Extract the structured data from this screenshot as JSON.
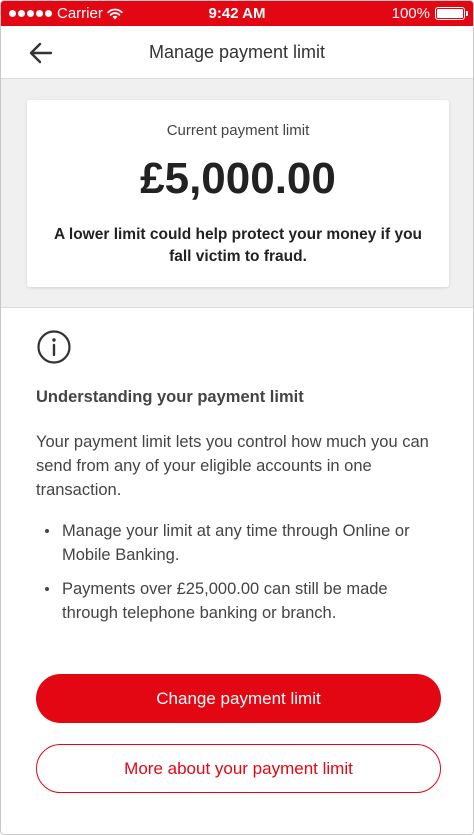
{
  "status_bar": {
    "carrier": "Carrier",
    "time": "9:42 AM",
    "battery": "100%",
    "color": "#e30613"
  },
  "header": {
    "title": "Manage payment limit",
    "back_icon": "arrow-left-icon"
  },
  "limit_card": {
    "label": "Current payment limit",
    "amount": "£5,000.00",
    "note": "A lower limit could help protect your money if you fall victim to fraud."
  },
  "info": {
    "icon": "info-icon",
    "heading": "Understanding your payment limit",
    "body": "Your payment limit lets you control how much you can send from any of your eligible accounts in one transaction.",
    "bullets": [
      "Manage your limit at any time through Online or Mobile Banking.",
      "Payments over £25,000.00 can still be made through telephone banking or branch."
    ]
  },
  "actions": {
    "primary_label": "Change payment limit",
    "secondary_label": "More about your payment limit",
    "accent_color": "#e30613"
  }
}
